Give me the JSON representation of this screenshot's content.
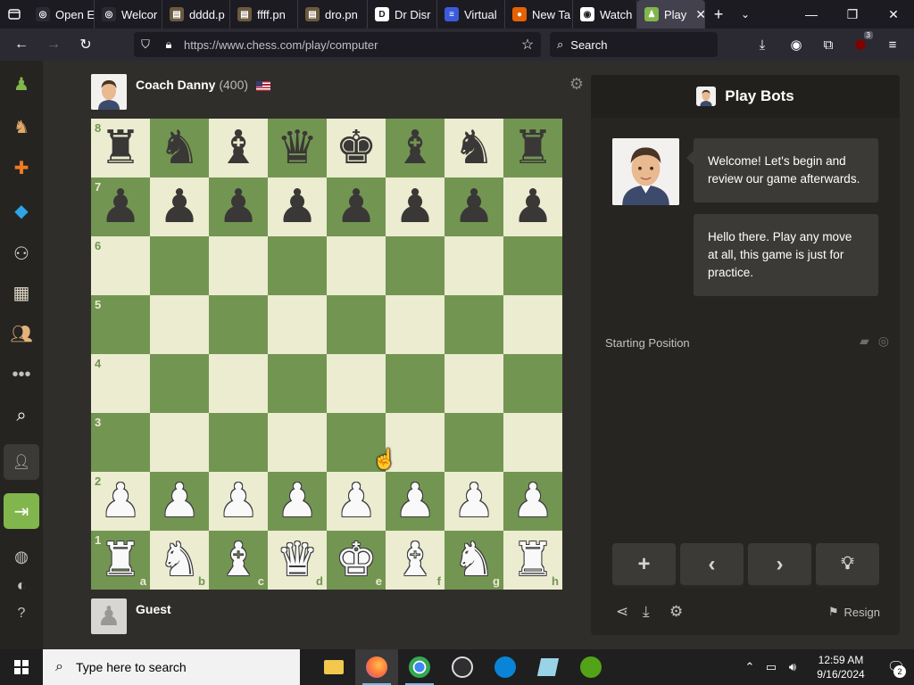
{
  "browser": {
    "tabs": [
      {
        "title": "Open E",
        "favicon_color": "#2b2a33",
        "favicon_glyph": "◎"
      },
      {
        "title": "Welcor",
        "favicon_color": "#2b2a33",
        "favicon_glyph": "◎"
      },
      {
        "title": "dddd.p",
        "favicon_color": "#6b5a3e",
        "favicon_glyph": "▤"
      },
      {
        "title": "ffff.pn",
        "favicon_color": "#6b5a3e",
        "favicon_glyph": "▤"
      },
      {
        "title": "dro.pn",
        "favicon_color": "#6b5a3e",
        "favicon_glyph": "▤"
      },
      {
        "title": "Dr Disr",
        "favicon_color": "#ffffff",
        "favicon_glyph": "D"
      },
      {
        "title": "Virtual",
        "favicon_color": "#3b5bdb",
        "favicon_glyph": "≡"
      },
      {
        "title": "New Ta",
        "favicon_color": "#e66000",
        "favicon_glyph": "●"
      },
      {
        "title": "Watch",
        "favicon_color": "#ffffff",
        "favicon_glyph": "◉"
      },
      {
        "title": "Play",
        "favicon_color": "#81b64c",
        "favicon_glyph": "♟"
      }
    ],
    "url": "https://www.chess.com/play/computer",
    "search_placeholder": "Search",
    "extension_badge": "3"
  },
  "game": {
    "opponent_name": "Coach Danny",
    "opponent_rating": "(400)",
    "player_name": "Guest",
    "ranks": [
      "8",
      "7",
      "6",
      "5",
      "4",
      "3",
      "2",
      "1"
    ],
    "files": [
      "a",
      "b",
      "c",
      "d",
      "e",
      "f",
      "g",
      "h"
    ],
    "position": [
      [
        "r",
        "n",
        "b",
        "q",
        "k",
        "b",
        "n",
        "r"
      ],
      [
        "p",
        "p",
        "p",
        "p",
        "p",
        "p",
        "p",
        "p"
      ],
      [
        "",
        "",
        "",
        "",
        "",
        "",
        "",
        ""
      ],
      [
        "",
        "",
        "",
        "",
        "",
        "",
        "",
        ""
      ],
      [
        "",
        "",
        "",
        "",
        "",
        "",
        "",
        ""
      ],
      [
        "",
        "",
        "",
        "",
        "",
        "",
        "",
        ""
      ],
      [
        "P",
        "P",
        "P",
        "P",
        "P",
        "P",
        "P",
        "P"
      ],
      [
        "R",
        "N",
        "B",
        "Q",
        "K",
        "B",
        "N",
        "R"
      ]
    ],
    "colors": {
      "light_square": "#ebecd0",
      "dark_square": "#739552",
      "accent": "#81b64c"
    }
  },
  "panel": {
    "title": "Play Bots",
    "messages": [
      "Welcome! Let's begin and review our game afterwards.",
      "Hello there. Play any move at all, this game is just for practice."
    ],
    "status": "Starting Position",
    "resign_label": "Resign"
  },
  "taskbar": {
    "search_placeholder": "Type here to search",
    "time": "12:59 AM",
    "date": "9/16/2024",
    "notification_count": "2"
  }
}
